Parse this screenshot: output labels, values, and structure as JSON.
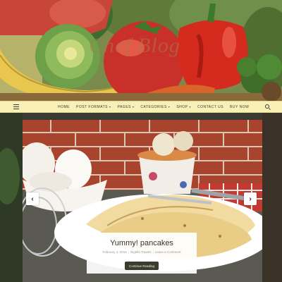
{
  "header": {
    "site_title": "Chef Blog"
  },
  "nav": {
    "menu_icon": "hamburger-icon",
    "items": [
      {
        "label": "Home",
        "has_dropdown": false
      },
      {
        "label": "Post Formats",
        "has_dropdown": true
      },
      {
        "label": "Pages",
        "has_dropdown": true
      },
      {
        "label": "Categories",
        "has_dropdown": true
      },
      {
        "label": "Shop",
        "has_dropdown": true
      },
      {
        "label": "Contact Us",
        "has_dropdown": false
      },
      {
        "label": "Buy Now",
        "has_dropdown": false
      }
    ],
    "search_icon": "search-icon",
    "background": "#f8f0b6"
  },
  "slider": {
    "prev_icon": "chevron-left-icon",
    "next_icon": "chevron-right-icon",
    "prev_glyph": "‹",
    "next_glyph": "›",
    "caption": {
      "title": "Yummy! pancakes",
      "date": "February 4, 2016",
      "category": "Nigella Travels",
      "comments": "Leave a Comment",
      "button_label": "Continue Reading"
    }
  },
  "colors": {
    "button_bg": "#3b3b30",
    "caret": "▾"
  }
}
